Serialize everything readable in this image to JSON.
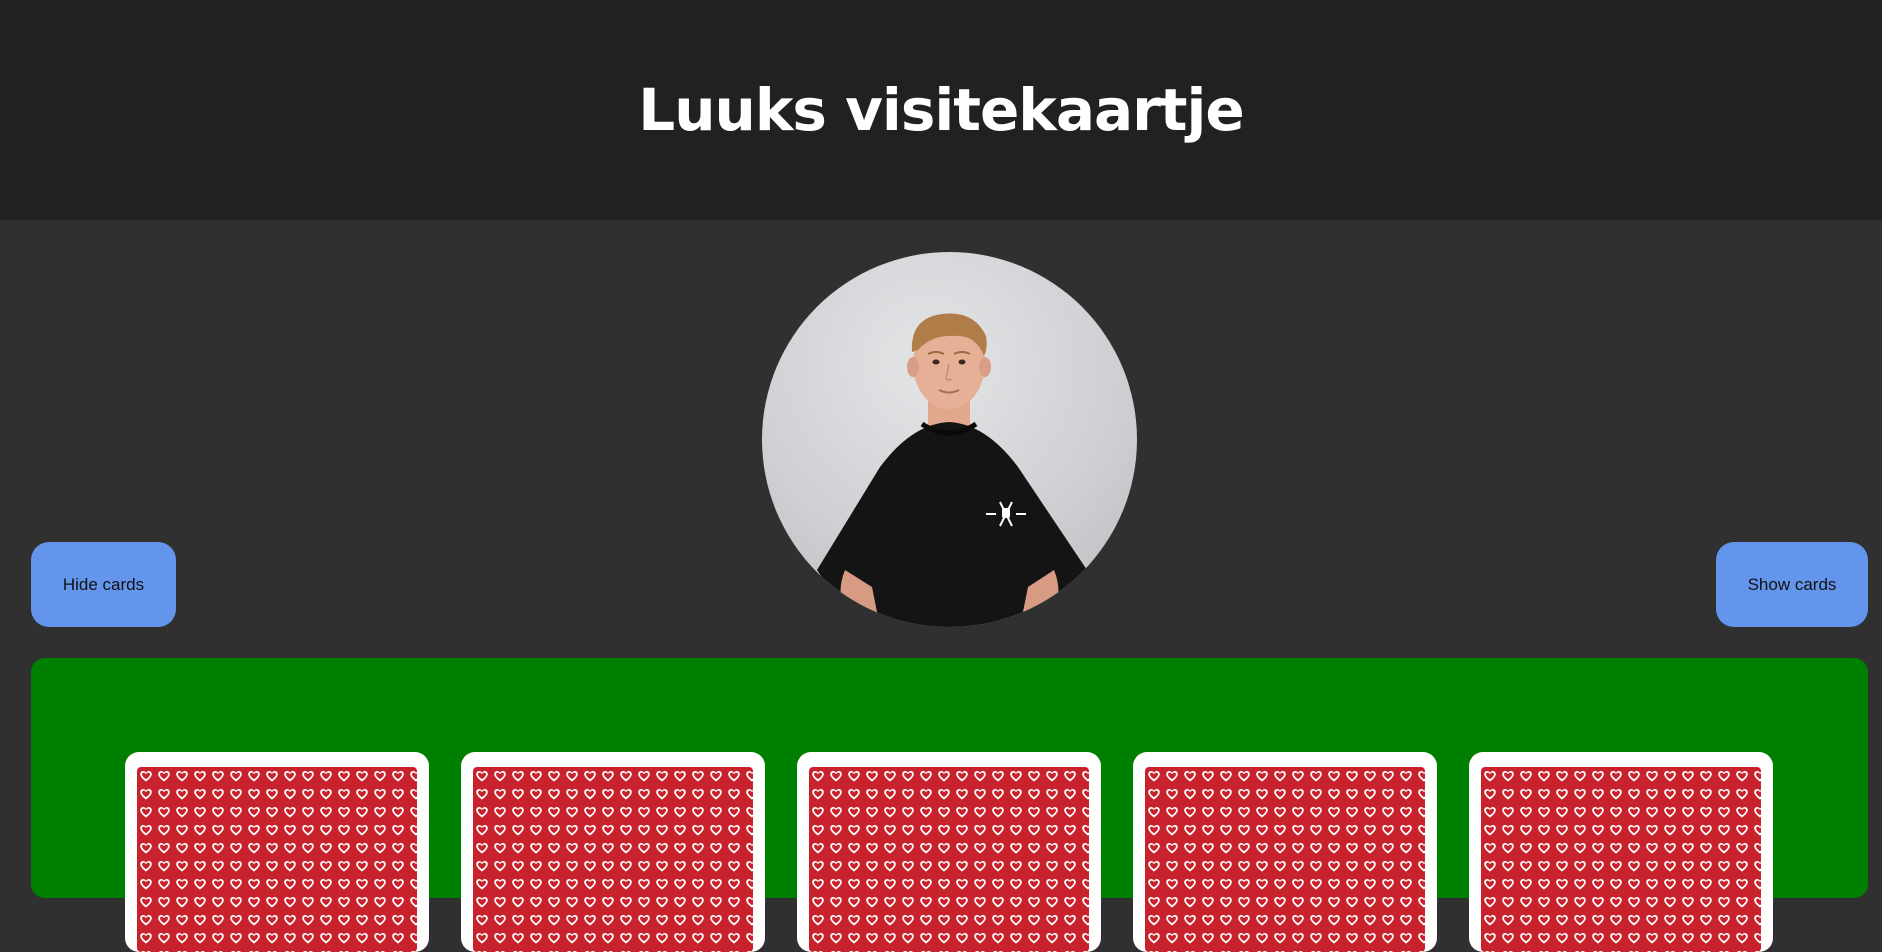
{
  "header": {
    "title": "Luuks visitekaartje"
  },
  "profile": {
    "avatar_icon": "person-photo-icon"
  },
  "controls": {
    "hide_label": "Hide cards",
    "show_label": "Show cards"
  },
  "cards": [
    {
      "face": "back",
      "pattern": "heart-pattern-icon"
    },
    {
      "face": "back",
      "pattern": "heart-pattern-icon"
    },
    {
      "face": "back",
      "pattern": "heart-pattern-icon"
    },
    {
      "face": "back",
      "pattern": "heart-pattern-icon"
    },
    {
      "face": "back",
      "pattern": "heart-pattern-icon"
    }
  ],
  "colors": {
    "header_bg": "#212121",
    "page_bg": "#303030",
    "button_bg": "#6495ed",
    "table_bg": "#008000",
    "card_pattern": "#c8232c"
  }
}
